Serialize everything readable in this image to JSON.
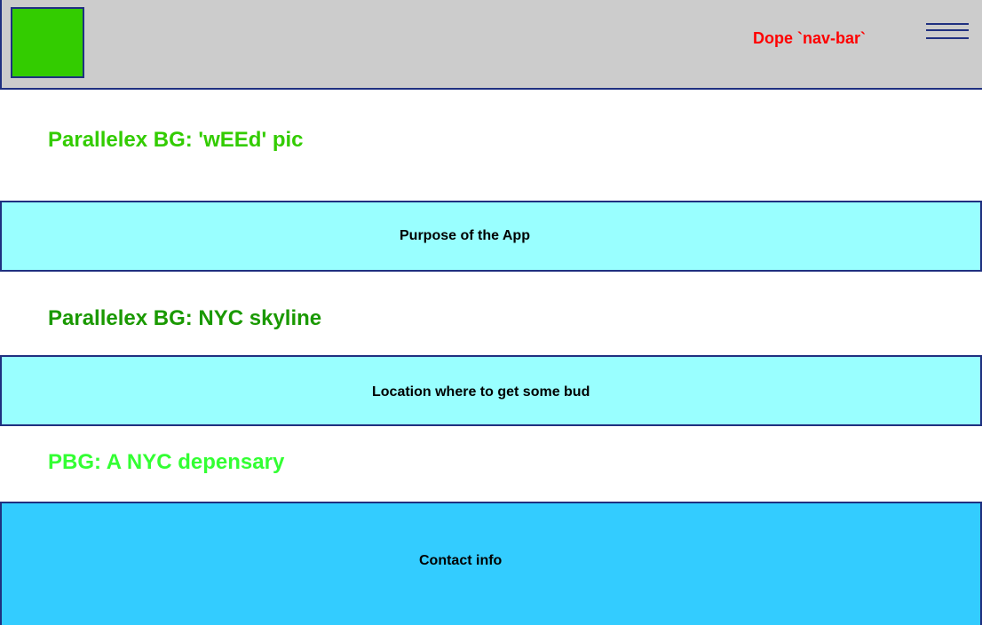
{
  "navbar": {
    "title": "Dope `nav-bar`",
    "logo_color": "#33cc00",
    "title_color": "#ff0000",
    "background": "#cccccc",
    "menu_icon": "hamburger-menu-icon"
  },
  "sections": {
    "heading_1": "Parallelex BG: 'wEEd' pic",
    "heading_2": "Parallelex BG: NYC skyline",
    "heading_3": "PBG: A NYC depensary"
  },
  "boxes": {
    "purpose": "Purpose of the App",
    "location": "Location where to get some bud",
    "contact": "Contact info"
  },
  "colors": {
    "border": "#1f3080",
    "light_cyan": "#99ffff",
    "sky_blue": "#33ccff",
    "green_1": "#33cc00",
    "green_2": "#1a9900",
    "green_3": "#33ff33"
  }
}
